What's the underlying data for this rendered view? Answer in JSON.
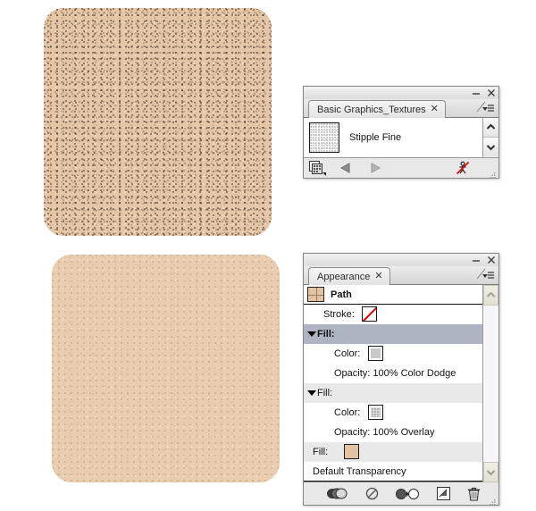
{
  "artwork": {
    "shapes": [
      {
        "name": "stipple-fine-square",
        "label": "Stipple Fine textured rounded square",
        "fill_color": "#e5c7a8"
      },
      {
        "name": "soft-texture-square",
        "label": "Soft textured rounded square",
        "fill_color": "#e8cdb1"
      }
    ]
  },
  "textures_panel": {
    "title": "Basic Graphics_Textures",
    "close_glyph": "✕",
    "minimize_glyph": "–",
    "window_close_glyph": "✕",
    "items": [
      {
        "name": "Stipple Fine",
        "thumb": "stipple-fine-swatch"
      }
    ],
    "footer": {
      "libraries_icon": "symbol-libraries-menu-icon",
      "prev_icon": "previous-page-icon",
      "next_icon": "next-page-icon",
      "break_link_icon": "break-link-to-symbol-icon"
    },
    "scroll": {
      "up": "scroll-up-icon",
      "down": "scroll-down-icon"
    }
  },
  "appearance_panel": {
    "title": "Appearance",
    "close_glyph": "✕",
    "minimize_glyph": "–",
    "window_close_glyph": "✕",
    "object_label": "Path",
    "rows": [
      {
        "type": "object",
        "label": "Path",
        "swatch": "path-thumbnail",
        "indent": 0,
        "bg": "white",
        "bold": true,
        "selected": false,
        "disclosure": false
      },
      {
        "type": "stroke",
        "label": "Stroke:",
        "swatch": "none-swatch",
        "indent": 1,
        "bg": "white",
        "bold": false,
        "selected": false,
        "disclosure": false
      },
      {
        "type": "fill",
        "label": "Fill:",
        "swatch": null,
        "indent": 0,
        "bg": "sel",
        "bold": true,
        "selected": true,
        "disclosure": true
      },
      {
        "type": "color",
        "label": "Color:",
        "swatch": "grey-swatch",
        "indent": 2,
        "bg": "white",
        "bold": false,
        "selected": false,
        "disclosure": false
      },
      {
        "type": "opacity",
        "label": "Opacity: 100% Color Dodge",
        "swatch": null,
        "indent": 2,
        "bg": "white",
        "bold": false,
        "selected": false,
        "disclosure": false
      },
      {
        "type": "fill",
        "label": "Fill:",
        "swatch": null,
        "indent": 0,
        "bg": "grey",
        "bold": false,
        "selected": false,
        "disclosure": true
      },
      {
        "type": "color",
        "label": "Color:",
        "swatch": "stipple-swatch",
        "indent": 2,
        "bg": "white",
        "bold": false,
        "selected": false,
        "disclosure": false
      },
      {
        "type": "opacity",
        "label": "Opacity: 100% Overlay",
        "swatch": null,
        "indent": 2,
        "bg": "white",
        "bold": false,
        "selected": false,
        "disclosure": false
      },
      {
        "type": "fill",
        "label": "Fill:",
        "swatch": "tan-swatch",
        "indent": 1,
        "bg": "grey",
        "bold": false,
        "selected": false,
        "disclosure": false
      },
      {
        "type": "transp",
        "label": "Default Transparency",
        "swatch": null,
        "indent": 1,
        "bg": "white",
        "bold": false,
        "selected": false,
        "disclosure": false
      }
    ],
    "footer": {
      "new_art_icon": "new-art-has-basic-appearance-icon",
      "clear_icon": "clear-appearance-icon",
      "reduce_icon": "reduce-to-basic-appearance-icon",
      "duplicate_icon": "duplicate-selected-item-icon",
      "delete_icon": "delete-selected-item-icon"
    },
    "scroll": {
      "up": "scroll-up-icon",
      "down": "scroll-down-icon"
    }
  },
  "colors": {
    "selected_row": "#aeb4c2",
    "alt_row": "#e9e9e9",
    "panel_bg": "#e8e8e8",
    "artwork_tan": "#e3c3a4",
    "none_red": "#e00000"
  }
}
